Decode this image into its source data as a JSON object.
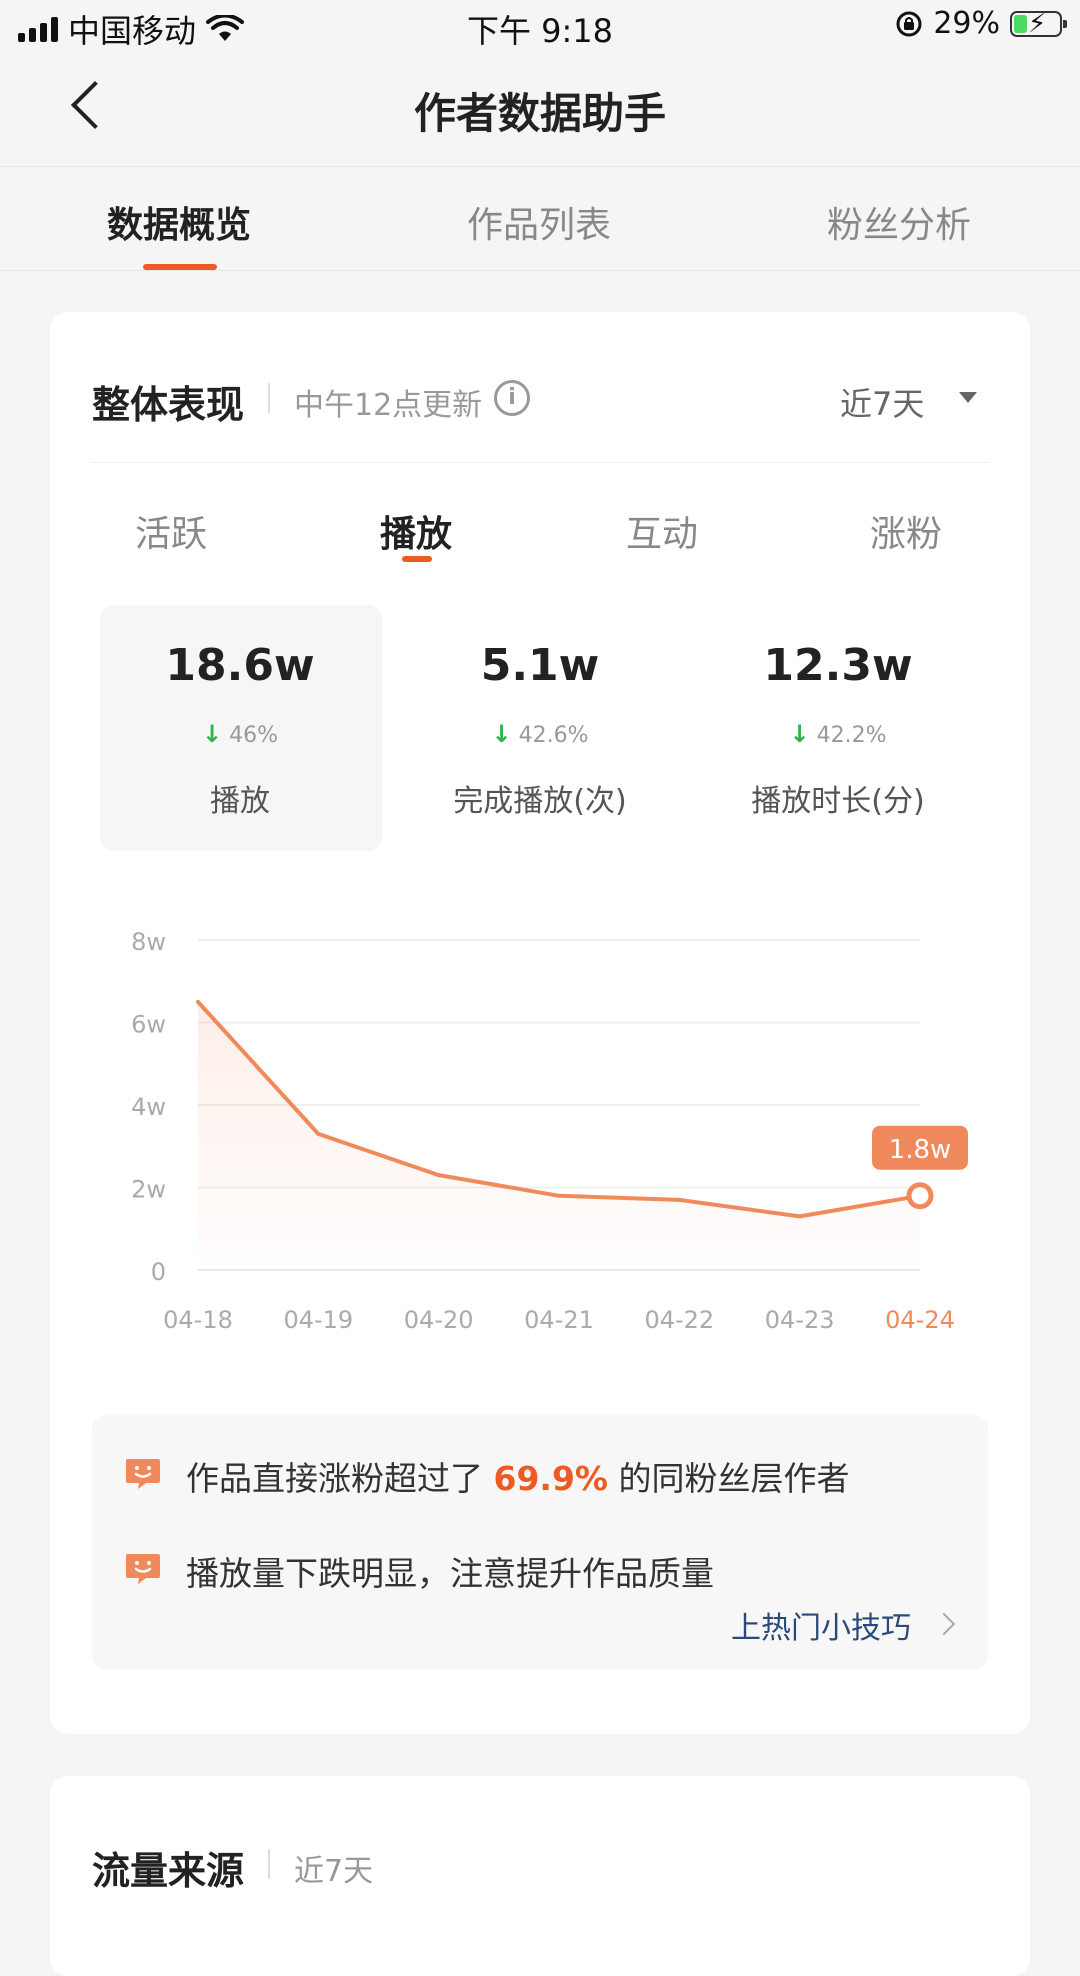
{
  "status_bar": {
    "carrier": "中国移动",
    "time": "下午 9:18",
    "battery_percent": "29%",
    "battery_level": 0.29,
    "colors": {
      "battery_fill": "#4cd964"
    }
  },
  "nav": {
    "title": "作者数据助手",
    "back_icon": "chevron-left-icon"
  },
  "tabs": [
    {
      "label": "数据概览",
      "active": true
    },
    {
      "label": "作品列表",
      "active": false
    },
    {
      "label": "粉丝分析",
      "active": false
    }
  ],
  "overview": {
    "title": "整体表现",
    "update_note": "中午12点更新",
    "range_label": "近7天",
    "sub_tabs": [
      {
        "label": "活跃",
        "active": false
      },
      {
        "label": "播放",
        "active": true
      },
      {
        "label": "互动",
        "active": false
      },
      {
        "label": "涨粉",
        "active": false
      }
    ],
    "metrics": [
      {
        "value": "18.6w",
        "change": "46%",
        "label": "播放",
        "selected": true
      },
      {
        "value": "5.1w",
        "change": "42.6%",
        "label": "完成播放(次)",
        "selected": false
      },
      {
        "value": "12.3w",
        "change": "42.2%",
        "label": "播放时长(分)",
        "selected": false
      }
    ],
    "tips": [
      {
        "prefix": "作品直接涨粉超过了 ",
        "highlight": "69.9%",
        "suffix": " 的同粉丝层作者"
      },
      {
        "prefix": "播放量下跌明显，注意提升作品质量",
        "highlight": "",
        "suffix": ""
      }
    ],
    "tips_link": "上热门小技巧"
  },
  "traffic": {
    "title": "流量来源",
    "range_label": "近7天"
  },
  "chart_data": {
    "type": "line",
    "categories": [
      "04-18",
      "04-19",
      "04-20",
      "04-21",
      "04-22",
      "04-23",
      "04-24"
    ],
    "series": [
      {
        "values": [
          6.5,
          3.3,
          2.3,
          1.8,
          1.7,
          1.3,
          1.8
        ]
      }
    ],
    "y_ticks": [
      "0",
      "2w",
      "4w",
      "6w",
      "8w"
    ],
    "ylim": [
      0,
      8
    ],
    "grid": true,
    "highlight": {
      "index": 6,
      "label": "1.8w"
    },
    "colors": {
      "line": "#f08a5d",
      "highlight_label": "#f08a5d",
      "tick": "#aaaaaa"
    }
  },
  "colors": {
    "accent": "#ee5a24",
    "down_arrow": "#2fb34a"
  }
}
